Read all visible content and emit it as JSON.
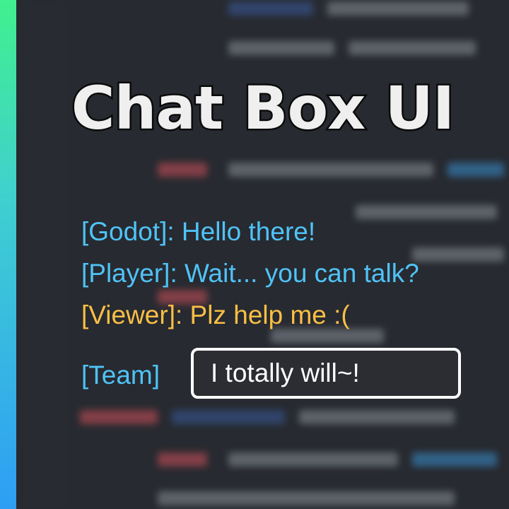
{
  "title": "Chat Box UI",
  "colors": {
    "accent_top": "#41f08f",
    "accent_bottom": "#2e9ef5",
    "message_blue": "#4fc3f7",
    "message_orange": "#fbbf45",
    "background": "#272a30",
    "input_border": "#ffffff"
  },
  "messages": [
    {
      "sender": "[Godot]",
      "text": ": Hello there!",
      "color": "blue"
    },
    {
      "sender": "[Player]",
      "text": ": Wait... you can talk?",
      "color": "blue"
    },
    {
      "sender": "[Viewer]",
      "text": ": Plz help me :(",
      "color": "orange"
    }
  ],
  "input": {
    "channel_label": "[Team]",
    "value": "I totally will~!"
  }
}
